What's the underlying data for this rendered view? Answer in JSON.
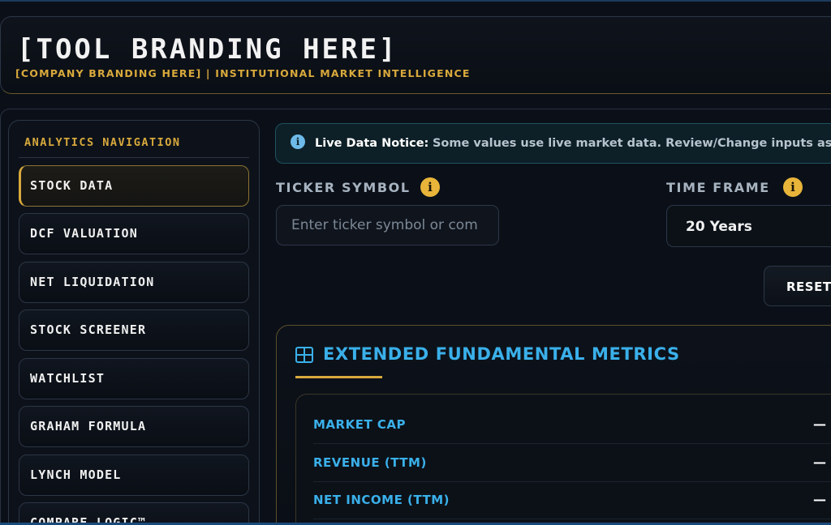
{
  "header": {
    "title": "[TOOL BRANDING HERE]",
    "subtitle": "[COMPANY BRANDING HERE] | INSTITUTIONAL MARKET INTELLIGENCE"
  },
  "sidebar": {
    "heading": "ANALYTICS NAVIGATION",
    "items": [
      {
        "label": "STOCK DATA",
        "active": true
      },
      {
        "label": "DCF VALUATION",
        "active": false
      },
      {
        "label": "NET LIQUIDATION",
        "active": false
      },
      {
        "label": "STOCK SCREENER",
        "active": false
      },
      {
        "label": "WATCHLIST",
        "active": false
      },
      {
        "label": "GRAHAM FORMULA",
        "active": false
      },
      {
        "label": "LYNCH MODEL",
        "active": false
      },
      {
        "label": "COMPARE LOGIC™",
        "active": false
      }
    ]
  },
  "notice": {
    "icon": "info-icon",
    "strong": "Live Data Notice:",
    "body": "Some values use live market data. Review/Change inputs as n"
  },
  "form": {
    "ticker_label": "TICKER SYMBOL",
    "ticker_placeholder": "Enter ticker symbol or com",
    "ticker_value": "",
    "timeframe_label": "TIME FRAME",
    "timeframe_value": "20 Years",
    "help_glyph": "i",
    "reset_label": "RESET"
  },
  "metrics": {
    "icon": "grid-icon",
    "title": "EXTENDED FUNDAMENTAL METRICS",
    "rows": [
      {
        "label": "MARKET CAP",
        "value": "—"
      },
      {
        "label": "REVENUE (TTM)",
        "value": "—"
      },
      {
        "label": "NET INCOME (TTM)",
        "value": "—"
      }
    ]
  },
  "colors": {
    "accent_gold": "#d8a93c",
    "accent_blue": "#3ab0ea",
    "background": "#0b1018"
  }
}
